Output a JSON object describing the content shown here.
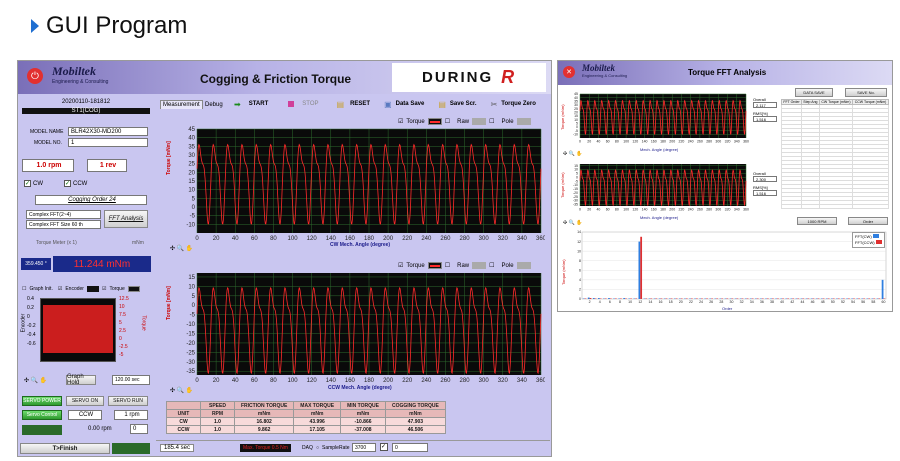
{
  "page": {
    "heading": "GUI Program"
  },
  "main": {
    "brand": "Mobiltek",
    "brand_sub": "Engineering & Consulting",
    "title": "Cogging & Friction Torque",
    "partner": "DURING",
    "date": "20200110-181812",
    "station": "ST1(COG)",
    "model_name_label": "MODEL NAME",
    "model_name": "BLR42X30-MD200",
    "model_no_label": "MODEL NO.",
    "model_no": "1",
    "speed": "1.0 rpm",
    "rev": "1 rev",
    "cw_label": "CW",
    "ccw_label": "CCW",
    "cogging_order": "Cogging Order 24",
    "fft1": "Complex FFT(2~4)",
    "fft2": "Complex FFT Size 60 th",
    "fft_analysis": "FFT Analysis",
    "torque_meter": "Torque Meter (x 1)",
    "torque_unit": "mNm",
    "angle_readout": "359.450 °",
    "torque_readout": "11.244 mNm",
    "graph_init": "Graph Init.",
    "encoder_cb": "Encoder",
    "torque_cb": "Torque",
    "encoder_axis": "Encoder",
    "torque_axis": "Torque",
    "graph_hold": "Graph Hold",
    "hold_time": "120.00 sec",
    "servo_power": "SERVO POWER",
    "servo_on": "SERVO ON",
    "servo_run": "SERVO RUN",
    "servo_control": "Servo Control",
    "dir": "CCW",
    "servo_rpm": "1 rpm",
    "rpm_readout": "0.00 rpm",
    "rpm_readout2": "0",
    "finish": "T>Finish",
    "tab_measure": "Measurement",
    "tab_debug": "Debug",
    "start": "START",
    "stop": "STOP",
    "reset": "RESET",
    "data_save": "Data Save",
    "save_scr": "Save Scr.",
    "torque_zero": "Torque Zero",
    "legend_torque": "Torque",
    "legend_raw": "Raw",
    "legend_pole": "Pole",
    "plot1_xlabel": "CW Mech. Angle (degree)",
    "plot2_xlabel": "CCW Mech. Angle (degree)",
    "plot_ylabel": "Torque [mNm]",
    "plot2_ymax": "17.105",
    "plot2_ymin": "-37.008",
    "status_time": "185.4 sec",
    "status_max": "Max. Torque 0.5 Nm",
    "status_daq": "DAQ",
    "status_rate_label": "SampleRate",
    "status_rate": "3700",
    "status_count": "0"
  },
  "results_table": {
    "headers": [
      "",
      "SPEED",
      "FRICTION TORQUE",
      "MAX TORQUE",
      "MIN TORQUE",
      "COGGING TORQUE"
    ],
    "units": [
      "UNIT",
      "RPM",
      "mNm",
      "mNm",
      "mNm",
      "mNm"
    ],
    "rows": [
      [
        "CW",
        "1.0",
        "16.802",
        "43.996",
        "-10.866",
        "47.903"
      ],
      [
        "CCW",
        "1.0",
        "9.862",
        "17.105",
        "-37.008",
        "46.506"
      ]
    ]
  },
  "fft": {
    "brand": "Mobiltek",
    "brand_sub": "Engineering & Consulting",
    "title": "Torque FFT Analysis",
    "overall_label": "Overall",
    "overall1": "2.117",
    "overall2": "2.300",
    "rms_label": "RMS[%]",
    "rms1": "1.516",
    "rms2": "1.516",
    "load_btn": "DATA SAVE",
    "save_btn": "SAVE No.",
    "speed_btn": "1000 RPM",
    "order_btn": "Order",
    "plot_xlabel": "Mech. Angle (degree)",
    "plot_ylabel": "Torque (mNm)",
    "chart_xlabel": "Order",
    "chart_ylabel": "Torque (mNm)",
    "legend_cw": "FFT(CW)",
    "legend_ccw": "FFT(CCW)",
    "table_headers": [
      "FFT Order",
      "Step Ang",
      "CW Torque (mNm)",
      "CCW Torque (mNm)"
    ]
  },
  "colors": {
    "trace": "#ff2a2a",
    "panel": "#c9c6f0",
    "plot_bg": "#0a0a0a",
    "blue_bar": "#2f7fe0",
    "red_bar": "#e03030"
  },
  "chart_data": [
    {
      "type": "line",
      "title": "",
      "xlabel": "CW Mech. Angle (degree)",
      "ylabel": "Torque [mNm]",
      "xlim": [
        0,
        360
      ],
      "ylim": [
        -15,
        45
      ],
      "x_ticks": [
        0,
        20,
        40,
        60,
        80,
        100,
        120,
        140,
        160,
        180,
        200,
        220,
        240,
        260,
        280,
        300,
        320,
        340,
        360
      ],
      "y_ticks": [
        -10,
        -5,
        0,
        5,
        10,
        15,
        20,
        25,
        30,
        35,
        40,
        45
      ],
      "series": [
        {
          "name": "Torque",
          "summary": {
            "max": 43.996,
            "min": -10.866,
            "mean": 16.802,
            "cycles": 24
          }
        }
      ]
    },
    {
      "type": "line",
      "title": "",
      "xlabel": "CCW Mech. Angle (degree)",
      "ylabel": "Torque [mNm]",
      "xlim": [
        0,
        360
      ],
      "ylim": [
        -37.008,
        17.105
      ],
      "x_ticks": [
        0,
        20,
        40,
        60,
        80,
        100,
        120,
        140,
        160,
        180,
        200,
        220,
        240,
        260,
        280,
        300,
        320,
        340,
        360
      ],
      "y_ticks": [
        -35,
        -30,
        -25,
        -20,
        -15,
        -10,
        -5,
        0,
        5,
        10,
        15
      ],
      "series": [
        {
          "name": "Torque",
          "summary": {
            "max": 17.105,
            "min": -37.008,
            "mean": -9.862,
            "cycles": 24
          }
        }
      ]
    },
    {
      "type": "bar",
      "title": "",
      "xlabel": "Order",
      "ylabel": "Torque (mNm)",
      "categories": [
        1,
        2,
        3,
        4,
        5,
        6,
        7,
        8,
        9,
        10,
        11,
        12,
        13,
        14,
        15,
        16,
        17,
        18,
        19,
        20,
        21,
        22,
        23,
        24,
        25,
        26,
        27,
        28,
        29,
        30,
        31,
        32,
        33,
        34,
        35,
        36,
        37,
        38,
        39,
        40,
        41,
        42,
        43,
        44,
        45,
        46,
        47,
        48,
        49,
        50,
        51,
        52,
        53,
        54,
        55,
        56,
        57,
        58,
        59,
        60
      ],
      "series": [
        {
          "name": "FFT(CW)",
          "values": [
            0.1,
            0.3,
            0.2,
            0.2,
            0.1,
            0.2,
            0.1,
            0.1,
            0.2,
            0.1,
            0.1,
            12,
            0.1,
            0.1,
            0.1,
            0.1,
            0.1,
            0.1,
            0.1,
            0.1,
            0.1,
            0.1,
            0.1,
            0.1,
            0.1,
            0.1,
            0.1,
            0.1,
            0.1,
            0.1,
            0.1,
            0.1,
            0.1,
            0.1,
            0.1,
            0.1,
            0.1,
            0.1,
            0.1,
            0.1,
            0.1,
            0.1,
            0.1,
            0.1,
            0.1,
            0.1,
            0.1,
            0.1,
            0.1,
            0.1,
            0.1,
            0.1,
            0.1,
            0.1,
            0.1,
            0.1,
            0.1,
            0.1,
            0.1,
            4.0
          ]
        },
        {
          "name": "FFT(CCW)",
          "values": [
            0.1,
            0.2,
            0.1,
            0.1,
            0.1,
            0.1,
            0.1,
            0.1,
            0.1,
            0.1,
            0.1,
            13,
            0.1,
            0.1,
            0.1,
            0.1,
            0.1,
            0.1,
            0.1,
            0.1,
            0.1,
            0.1,
            0.1,
            0.1,
            0.1,
            0.1,
            0.1,
            0.1,
            0.1,
            0.1,
            0.1,
            0.1,
            0.1,
            0.1,
            0.1,
            0.1,
            0.1,
            0.1,
            0.1,
            0.1,
            0.1,
            0.1,
            0.1,
            0.1,
            0.1,
            0.1,
            0.1,
            0.1,
            0.1,
            0.1,
            0.1,
            0.1,
            0.1,
            0.1,
            0.1,
            0.1,
            0.1,
            0.1,
            0.1,
            0.1
          ]
        }
      ],
      "ylim": [
        0,
        14
      ]
    }
  ]
}
